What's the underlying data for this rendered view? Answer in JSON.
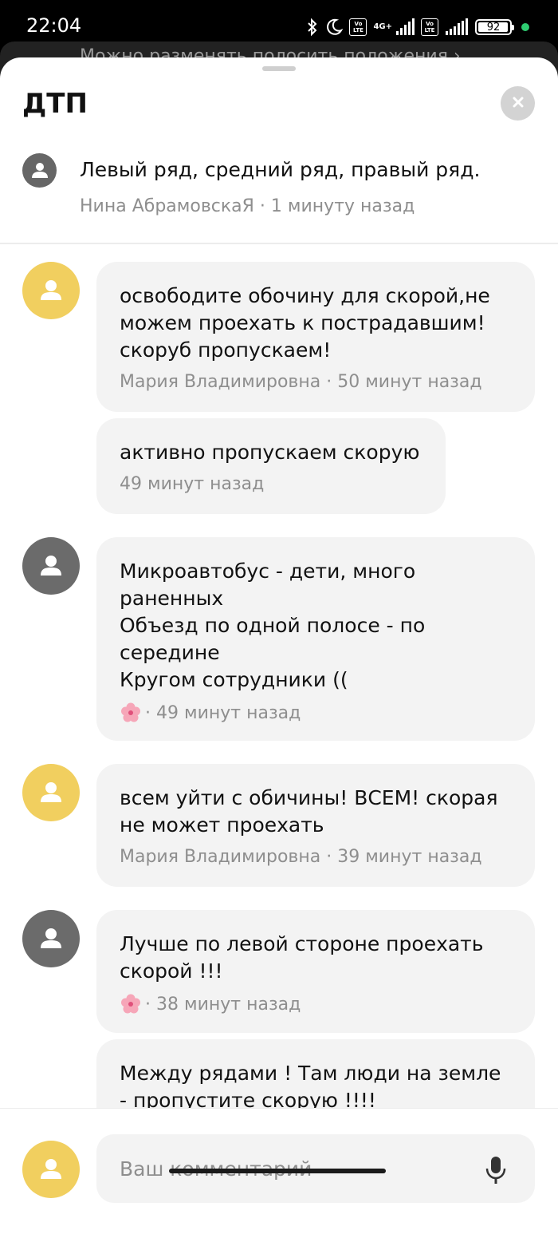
{
  "status_bar": {
    "time": "22:04",
    "battery_level": "92",
    "network_label": "4G+",
    "lte_badge_top": "Vo",
    "lte_badge_bottom": "LTE"
  },
  "behind_text": "Можно разменять полосить положения ›",
  "sheet": {
    "title": "ДТП"
  },
  "pinned": {
    "text": "Левый ряд, средний ряд, правый ряд.",
    "meta": "Нина АбрамовскаЯ · 1 минуту назад"
  },
  "comments": [
    {
      "avatar_color": "yellow",
      "text": "освободите обочину для скорой,не\nможем проехать к пострадавшим!\nскоруб пропускаем!",
      "meta": "Мария Владимировна · 50 минут назад"
    },
    {
      "text": "активно пропускаем скорую",
      "meta": "49 минут назад"
    },
    {
      "avatar_color": "gray",
      "text": "Микроавтобус - дети, много\nраненных\nОбъезд по одной полосе - по\nсередине\nКругом сотрудники ((",
      "meta": "· 49 минут назад",
      "meta_icon": "flower-icon"
    },
    {
      "avatar_color": "yellow",
      "text": "всем уйти с обичины! ВСЕМ! скорая\nне может проехать",
      "meta": "Мария Владимировна · 39 минут назад"
    },
    {
      "avatar_color": "gray",
      "text": "Лучше по левой стороне проехать\nскорой !!!",
      "meta": "· 38 минут назад",
      "meta_icon": "flower-icon"
    },
    {
      "text": "Между рядами ! Там люди на земле\n- пропустите скорую !!!!",
      "meta": ""
    }
  ],
  "input": {
    "placeholder": "Ваш комментарий"
  },
  "colors": {
    "avatar_yellow": "#f1cf5f",
    "avatar_gray": "#6b6b6b",
    "bubble_bg": "#f3f3f3",
    "meta_text": "#8e8e8e"
  }
}
